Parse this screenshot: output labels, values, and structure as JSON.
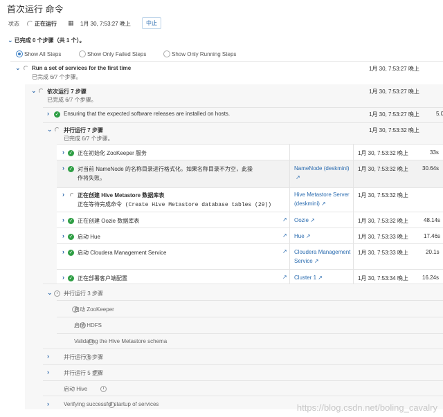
{
  "header": {
    "title": "首次运行 命令",
    "status_label": "状态",
    "status_value": "正在运行",
    "started": "1月 30, 7:53:27 晚上",
    "stop_label": "中止"
  },
  "summary": "已完成 0 个步骤（共 1 个）。",
  "filters": [
    "Show All Steps",
    "Show Only Failed Steps",
    "Show Only Running Steps"
  ],
  "root": {
    "name": "Run a set of services for the first time",
    "progress": "已完成 6/7 个步骤。",
    "time": "1月 30, 7:53:27 晚上"
  },
  "seq": {
    "name": "依次运行 7 步骤",
    "progress": "已完成 6/7 个步骤。",
    "time": "1月 30, 7:53:27 晚上"
  },
  "ensure": {
    "name": "Ensuring that the expected software releases are installed on hosts.",
    "time": "1月 30, 7:53:27 晚上",
    "duration": "5.0"
  },
  "par7": {
    "name": "并行运行 7 步骤",
    "progress": "已完成 6/7 个步骤。",
    "time": "1月 30, 7:53:32 晚上"
  },
  "steps": [
    {
      "name": "正在初始化 ZooKeeper 服务",
      "time": "1月 30, 7:53:32 晚上",
      "duration": "33s"
    },
    {
      "name": "对当前 NameNode 的名称目录进行格式化。如果名称目录不为空，此操",
      "name2": "作将失败。",
      "target": "NameNode (deskmini)",
      "time": "1月 30, 7:53:32 晚上",
      "duration": "30.64s"
    },
    {
      "name": "正在创建 Hive Metastore 数据库表",
      "name2": "正在等待完成命令 (Create Hive Metastore database tables (29))",
      "target": "Hive Metastore Server",
      "target2": "(deskmini)",
      "time": "1月 30, 7:53:32 晚上"
    },
    {
      "name": "正在创建 Oozie 数据库表",
      "target": "Oozie",
      "time": "1月 30, 7:53:32 晚上",
      "duration": "48.14s"
    },
    {
      "name": "启动 Hue",
      "target": "Hue",
      "time": "1月 30, 7:53:33 晚上",
      "duration": "17.46s"
    },
    {
      "name": "启动 Cloudera Management Service",
      "target": "Cloudera Management",
      "target2": "Service",
      "time": "1月 30, 7:53:33 晚上",
      "duration": "20.1s"
    },
    {
      "name": "正在部署客户端配置",
      "target": "Cluster 1",
      "time": "1月 30, 7:53:34 晚上",
      "duration": "16.24s"
    }
  ],
  "par3": {
    "name": "并行运行 3 步骤",
    "children": [
      "启动 ZooKeeper",
      "启动 HDFS",
      "Validating the Hive Metastore schema"
    ]
  },
  "tail": [
    "并行运行 6 步骤",
    "并行运行 5 步骤",
    "启动 Hive",
    "Verifying successful startup of services"
  ],
  "watermark": "https://blog.csdn.net/boling_cavalry"
}
